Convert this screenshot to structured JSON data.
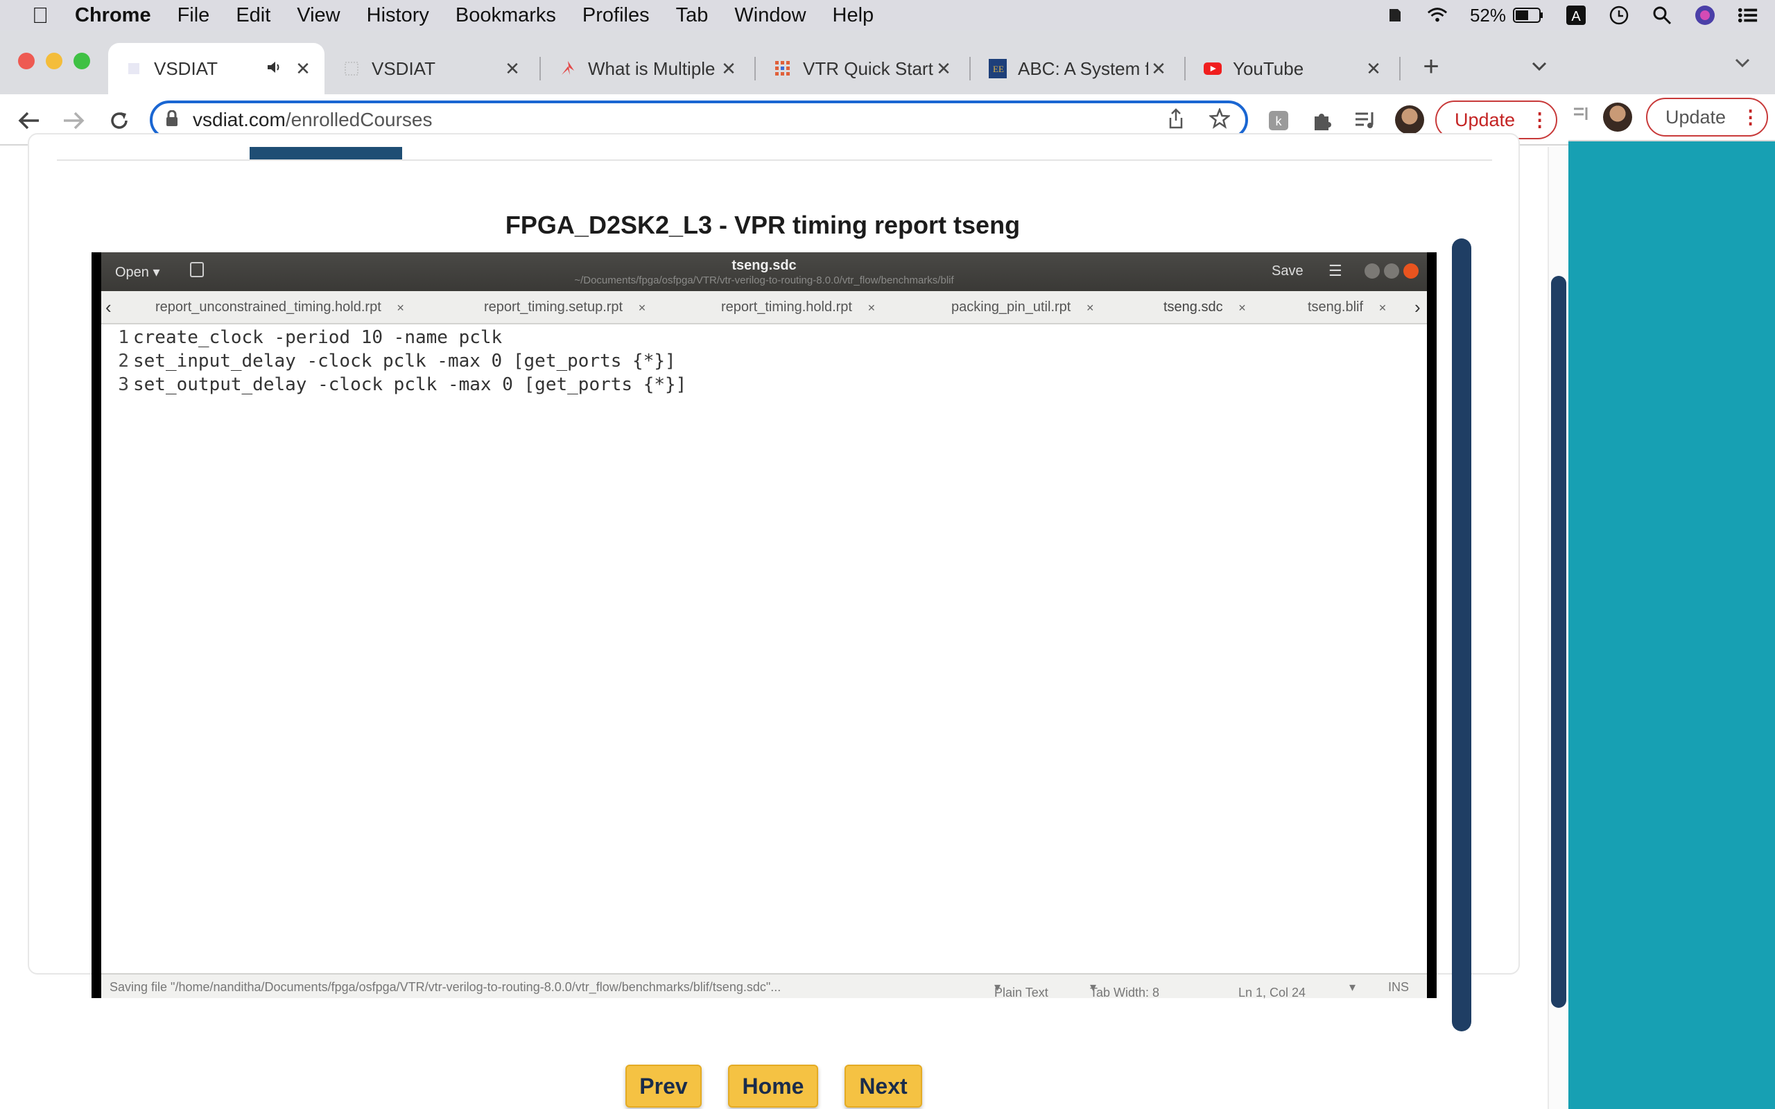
{
  "menubar": {
    "app_name": "Chrome",
    "items": [
      "File",
      "Edit",
      "View",
      "History",
      "Bookmarks",
      "Profiles",
      "Tab",
      "Window",
      "Help"
    ],
    "battery": "52%"
  },
  "tabs": [
    {
      "title": "VSDIAT",
      "active": true,
      "audio": true
    },
    {
      "title": "VSDIAT"
    },
    {
      "title": "What is Multiple"
    },
    {
      "title": "VTR Quick Start"
    },
    {
      "title": "ABC: A System f"
    },
    {
      "title": "YouTube"
    }
  ],
  "address_bar": {
    "domain": "vsdiat.com",
    "path": "/enrolledCourses"
  },
  "update_label": "Update",
  "lesson": {
    "title": "FPGA_D2SK2_L3 - VPR timing report tseng"
  },
  "gedit": {
    "open_label": "Open",
    "file_name": "tseng.sdc",
    "file_path": "~/Documents/fpga/osfpga/VTR/vtr-verilog-to-routing-8.0.0/vtr_flow/benchmarks/blif",
    "save_label": "Save",
    "tabs": [
      {
        "label": "report_unconstrained_timing.hold.rpt"
      },
      {
        "label": "report_timing.setup.rpt"
      },
      {
        "label": "report_timing.hold.rpt"
      },
      {
        "label": "packing_pin_util.rpt"
      },
      {
        "label": "tseng.sdc",
        "active": true
      },
      {
        "label": "tseng.blif"
      }
    ],
    "lines": [
      {
        "num": "1",
        "text": "create_clock -period 10 -name pclk"
      },
      {
        "num": "2",
        "text": "set_input_delay -clock pclk -max 0 [get_ports {*}]"
      },
      {
        "num": "3",
        "text": "set_output_delay -clock pclk -max 0 [get_ports {*}]"
      }
    ],
    "status": {
      "message": "Saving file \"/home/nanditha/Documents/fpga/osfpga/VTR/vtr-verilog-to-routing-8.0.0/vtr_flow/benchmarks/blif/tseng.sdc\"...",
      "language": "Plain Text",
      "tab_width": "Tab Width: 8",
      "position": "Ln 1, Col 24",
      "mode": "INS"
    }
  },
  "nav": {
    "prev": "Prev",
    "home": "Home",
    "next": "Next"
  }
}
